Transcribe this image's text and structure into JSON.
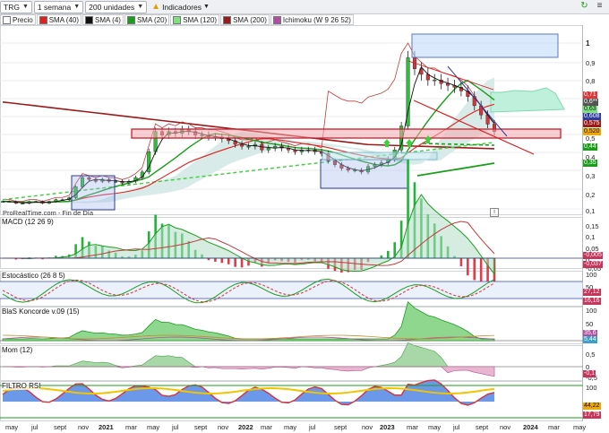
{
  "toolbar": {
    "ticker": "TRG",
    "timeframe": "1 semana",
    "units": "200 unidades",
    "indicators": "Indicadores"
  },
  "legend": [
    {
      "label": "Precio",
      "color": "#ffffff"
    },
    {
      "label": "SMA (40)",
      "color": "#e02020"
    },
    {
      "label": "SMA (4)",
      "color": "#111111"
    },
    {
      "label": "SMA (20)",
      "color": "#1a9e1a"
    },
    {
      "label": "SMA (120)",
      "color": "#7fe07f"
    },
    {
      "label": "SMA (200)",
      "color": "#9b1b1b"
    },
    {
      "label": "Ichimoku (W 9 26 52)",
      "color": "#b04fa0"
    }
  ],
  "credit": "ProRealTime.com - Fin de Día",
  "info_icon": "i",
  "panels": {
    "macd": "MACD (12 26 9)",
    "stoch": "Estocástico (26 8 5)",
    "koncorde": "BlaS Koncorde v.09 (15)",
    "mom": "Mom (12)",
    "rsi": "FILTRO RSI"
  },
  "price_axis": {
    "ticks": [
      "1",
      "0,9",
      "0,8",
      "0,7",
      "0,6",
      "0,5",
      "0,4",
      "0,3",
      "0,2",
      "0,1"
    ],
    "tags": [
      {
        "text": "0,71",
        "color": "#d83a3a"
      },
      {
        "text": "0,6**",
        "color": "#555555"
      },
      {
        "text": "0,63",
        "color": "#7fe07f"
      },
      {
        "text": "0,608",
        "color": "#2d3a9c"
      },
      {
        "text": "0,575",
        "color": "#9b1b1b"
      },
      {
        "text": "0,520",
        "color": "#f3a800"
      },
      {
        "text": "0,44",
        "color": "#1a9e1a"
      },
      {
        "text": "0,35",
        "color": "#1a9e1a"
      }
    ]
  },
  "macd_axis": {
    "ticks": [
      "0,15",
      "0,1",
      "0,05",
      "0",
      "-0,05"
    ],
    "tags": [
      "-0,005",
      "-0,037"
    ]
  },
  "stoch_axis": {
    "ticks": [
      "100",
      "50"
    ],
    "tags": [
      "27,12",
      "16,16"
    ]
  },
  "konc_axis": {
    "ticks": [
      "100",
      "50"
    ],
    "tags": [
      "35,6",
      "5,44"
    ]
  },
  "mom_axis": {
    "ticks": [
      "0,5",
      "0",
      "-0,5"
    ],
    "tags": [
      "-0,1"
    ]
  },
  "rsi_axis": {
    "ticks": [
      "100"
    ],
    "tags": [
      "44,22",
      "17,79"
    ]
  },
  "xaxis": [
    {
      "label": "may",
      "year": false
    },
    {
      "label": "jul",
      "year": false
    },
    {
      "label": "sept",
      "year": false
    },
    {
      "label": "nov",
      "year": false
    },
    {
      "label": "2021",
      "year": true
    },
    {
      "label": "mar",
      "year": false
    },
    {
      "label": "may",
      "year": false
    },
    {
      "label": "jul",
      "year": false
    },
    {
      "label": "sept",
      "year": false
    },
    {
      "label": "nov",
      "year": false
    },
    {
      "label": "2022",
      "year": true
    },
    {
      "label": "mar",
      "year": false
    },
    {
      "label": "may",
      "year": false
    },
    {
      "label": "jul",
      "year": false
    },
    {
      "label": "sept",
      "year": false
    },
    {
      "label": "nov",
      "year": false
    },
    {
      "label": "2023",
      "year": true
    },
    {
      "label": "mar",
      "year": false
    },
    {
      "label": "may",
      "year": false
    },
    {
      "label": "jul",
      "year": false
    },
    {
      "label": "sept",
      "year": false
    },
    {
      "label": "nov",
      "year": false
    },
    {
      "label": "2024",
      "year": true
    },
    {
      "label": "mar",
      "year": false
    },
    {
      "label": "may",
      "year": false
    }
  ],
  "price_series": [
    0.14,
    0.14,
    0.13,
    0.13,
    0.14,
    0.14,
    0.13,
    0.14,
    0.15,
    0.15,
    0.16,
    0.22,
    0.27,
    0.26,
    0.25,
    0.26,
    0.25,
    0.25,
    0.24,
    0.25,
    0.27,
    0.3,
    0.41,
    0.52,
    0.5,
    0.52,
    0.51,
    0.53,
    0.52,
    0.5,
    0.5,
    0.49,
    0.49,
    0.48,
    0.47,
    0.45,
    0.44,
    0.44,
    0.45,
    0.42,
    0.43,
    0.44,
    0.43,
    0.42,
    0.41,
    0.42,
    0.42,
    0.41,
    0.4,
    0.36,
    0.34,
    0.32,
    0.31,
    0.31,
    0.3,
    0.33,
    0.34,
    0.35,
    0.37,
    0.42,
    0.55,
    0.92,
    0.86,
    0.83,
    0.8,
    0.8,
    0.78,
    0.77,
    0.76,
    0.74,
    0.71,
    0.66,
    0.61,
    0.56,
    0.52
  ]
}
